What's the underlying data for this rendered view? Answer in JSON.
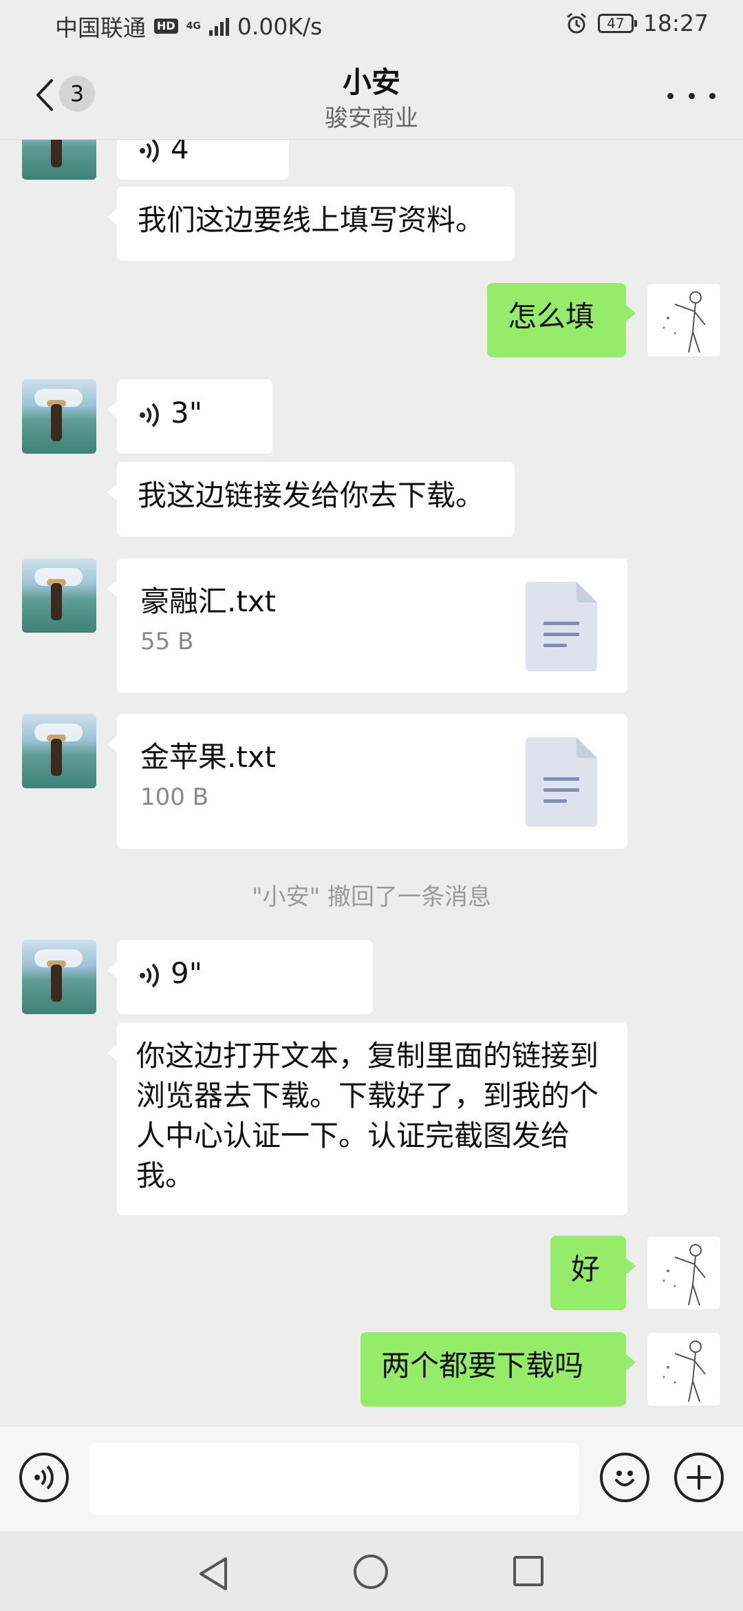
{
  "status_bar": {
    "carrier": "中国联通",
    "hd": "HD",
    "network": "4G",
    "speed": "0.00K/s",
    "battery": "47",
    "time": "18:27"
  },
  "header": {
    "unread_count": "3",
    "title": "小安",
    "subtitle": "骏安商业"
  },
  "messages": {
    "m1_voice": "4",
    "m2_text": "我们这边要线上填写资料。",
    "m3_text": "怎么填",
    "m4_voice": "3\"",
    "m5_text": "我这边链接发给你去下载。",
    "m6_file": {
      "name": "豪融汇.txt",
      "size": "55 B"
    },
    "m7_file": {
      "name": "金苹果.txt",
      "size": "100 B"
    },
    "system_recall": "\"小安\" 撤回了一条消息",
    "m8_voice": "9\"",
    "m9_text": "你这边打开文本，复制里面的链接到浏览器去下载。下载好了，到我的个人中心认证一下。认证完截图发给我。",
    "m10_text": "好",
    "m11_text": "两个都要下载吗"
  },
  "colors": {
    "background": "#ededed",
    "bubble_self": "#95ec69",
    "bubble_other": "#ffffff"
  }
}
